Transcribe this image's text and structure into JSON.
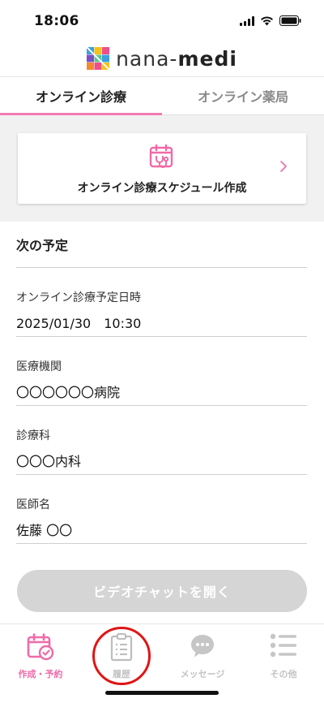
{
  "status_bar": {
    "time": "18:06"
  },
  "brand": {
    "name_light": "nana-",
    "name_bold": "medi"
  },
  "tabs": [
    {
      "label": "オンライン診療",
      "active": true
    },
    {
      "label": "オンライン薬局",
      "active": false
    }
  ],
  "schedule_card": {
    "label": "オンライン診療スケジュール作成"
  },
  "next_appointment": {
    "title": "次の予定",
    "fields": [
      {
        "label": "オンライン診療予定日時",
        "value": "2025/01/30　10:30"
      },
      {
        "label": "医療機関",
        "value": "〇〇〇〇〇〇病院"
      },
      {
        "label": "診療科",
        "value": "〇〇〇内科"
      },
      {
        "label": "医師名",
        "value": "佐藤 〇〇"
      }
    ]
  },
  "video_button": {
    "label": "ビデオチャットを開く"
  },
  "bottom_nav": [
    {
      "label": "作成・予約",
      "icon": "calendar-check-icon",
      "active": true
    },
    {
      "label": "履歴",
      "icon": "clipboard-list-icon",
      "active": false
    },
    {
      "label": "メッセージ",
      "icon": "chat-bubble-icon",
      "active": false
    },
    {
      "label": "その他",
      "icon": "menu-list-icon",
      "active": false
    }
  ],
  "colors": {
    "accent": "#f27bb3",
    "disabled": "#d5d5d5",
    "highlight": "#e01515"
  }
}
